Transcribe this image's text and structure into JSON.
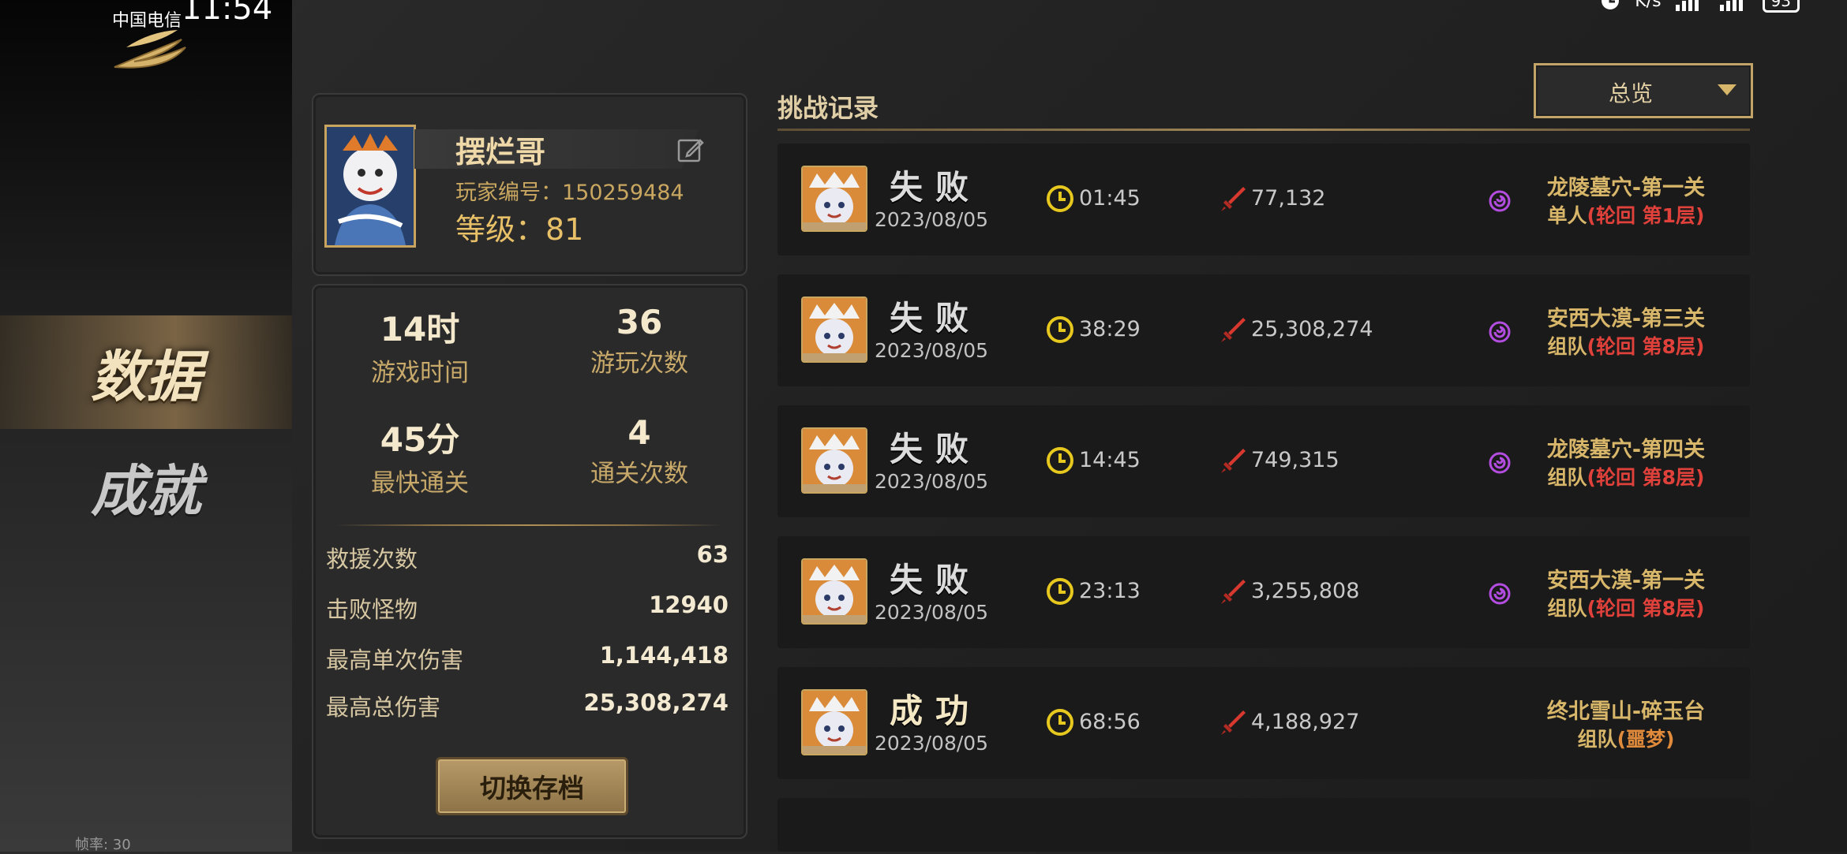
{
  "status_bar": {
    "carrier": "中国电信",
    "time": "11:54",
    "net_speed": "K/s",
    "battery": "93"
  },
  "sidebar": {
    "tabs": [
      {
        "label": "数据",
        "active": true
      },
      {
        "label": "成就",
        "active": false
      }
    ],
    "fps_label": "帧率: 30"
  },
  "profile": {
    "name": "摆烂哥",
    "player_id": "玩家编号：150259484",
    "level": "等级：81"
  },
  "stats": {
    "play_time": {
      "value": "14时",
      "label": "游戏时间"
    },
    "play_count": {
      "value": "36",
      "label": "游玩次数"
    },
    "fastest_clear": {
      "value": "45分",
      "label": "最快通关"
    },
    "clear_count": {
      "value": "4",
      "label": "通关次数"
    },
    "rows": [
      {
        "label": "救援次数",
        "value": "63"
      },
      {
        "label": "击败怪物",
        "value": "12940"
      },
      {
        "label": "最高单次伤害",
        "value": "1,144,418"
      },
      {
        "label": "最高总伤害",
        "value": "25,308,274"
      }
    ],
    "switch_button": "切换存档"
  },
  "records": {
    "title": "挑战记录",
    "filter": "总览",
    "items": [
      {
        "result": "失败",
        "date": "2023/08/05",
        "time": "01:45",
        "damage": "77,132",
        "stage": "龙陵墓穴-第一关",
        "mode": "单人",
        "mode_extra": "(轮回  第1层)",
        "swirl": true,
        "win": false
      },
      {
        "result": "失败",
        "date": "2023/08/05",
        "time": "38:29",
        "damage": "25,308,274",
        "stage": "安西大漠-第三关",
        "mode": "组队",
        "mode_extra": "(轮回  第8层)",
        "swirl": true,
        "win": false
      },
      {
        "result": "失败",
        "date": "2023/08/05",
        "time": "14:45",
        "damage": "749,315",
        "stage": "龙陵墓穴-第四关",
        "mode": "组队",
        "mode_extra": "(轮回  第8层)",
        "swirl": true,
        "win": false
      },
      {
        "result": "失败",
        "date": "2023/08/05",
        "time": "23:13",
        "damage": "3,255,808",
        "stage": "安西大漠-第一关",
        "mode": "组队",
        "mode_extra": "(轮回  第8层)",
        "swirl": true,
        "win": false
      },
      {
        "result": "成功",
        "date": "2023/08/05",
        "time": "68:56",
        "damage": "4,188,927",
        "stage": "终北雪山-碎玉台",
        "mode": "组队",
        "mode_extra": "(噩梦)",
        "swirl": false,
        "win": true
      }
    ]
  },
  "colors": {
    "gold": "#c9a760",
    "red": "#e0413b",
    "purple": "#b24de0",
    "clock_yellow": "#e6c81e"
  }
}
